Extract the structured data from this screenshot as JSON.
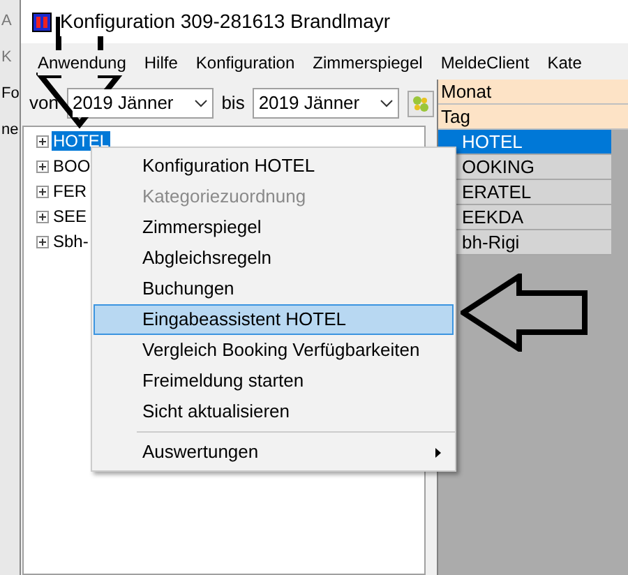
{
  "background_window": {
    "texts": [
      "A",
      "K",
      "Fo",
      "ne"
    ]
  },
  "window": {
    "title": "Konfiguration 309-281613 Brandlmayr"
  },
  "menu": [
    "Anwendung",
    "Hilfe",
    "Konfiguration",
    "Zimmerspiegel",
    "MeldeClient",
    "Kate"
  ],
  "toolbar": {
    "from_label": "von",
    "from_value": "2019 Jänner",
    "to_label": "bis",
    "to_value": "2019 Jänner"
  },
  "tree": [
    {
      "label": "HOTEL",
      "selected": true
    },
    {
      "label": "BOO",
      "selected": false
    },
    {
      "label": "FER",
      "selected": false
    },
    {
      "label": "SEE",
      "selected": false
    },
    {
      "label": "Sbh-",
      "selected": false
    }
  ],
  "grid": {
    "header_rows": [
      "Monat",
      "Tag"
    ],
    "rows": [
      {
        "label": "HOTEL",
        "selected": true
      },
      {
        "label": "OOKING",
        "selected": false
      },
      {
        "label": "ERATEL",
        "selected": false
      },
      {
        "label": "EEKDA",
        "selected": false
      },
      {
        "label": "bh-Rigi",
        "selected": false
      }
    ]
  },
  "context_menu": [
    {
      "label": "Konfiguration HOTEL",
      "disabled": false,
      "selected": false
    },
    {
      "label": "Kategoriezuordnung",
      "disabled": true,
      "selected": false
    },
    {
      "label": "Zimmerspiegel",
      "disabled": false,
      "selected": false
    },
    {
      "label": "Abgleichsregeln",
      "disabled": false,
      "selected": false
    },
    {
      "label": "Buchungen",
      "disabled": false,
      "selected": false
    },
    {
      "label": "Eingabeassistent HOTEL",
      "disabled": false,
      "selected": true
    },
    {
      "label": "Vergleich Booking Verfügbarkeiten",
      "disabled": false,
      "selected": false
    },
    {
      "label": "Freimeldung starten",
      "disabled": false,
      "selected": false
    },
    {
      "label": "Sicht aktualisieren",
      "disabled": false,
      "selected": false
    },
    {
      "label": "Auswertungen",
      "disabled": false,
      "selected": false,
      "submenu": true,
      "separator_before": true
    }
  ]
}
